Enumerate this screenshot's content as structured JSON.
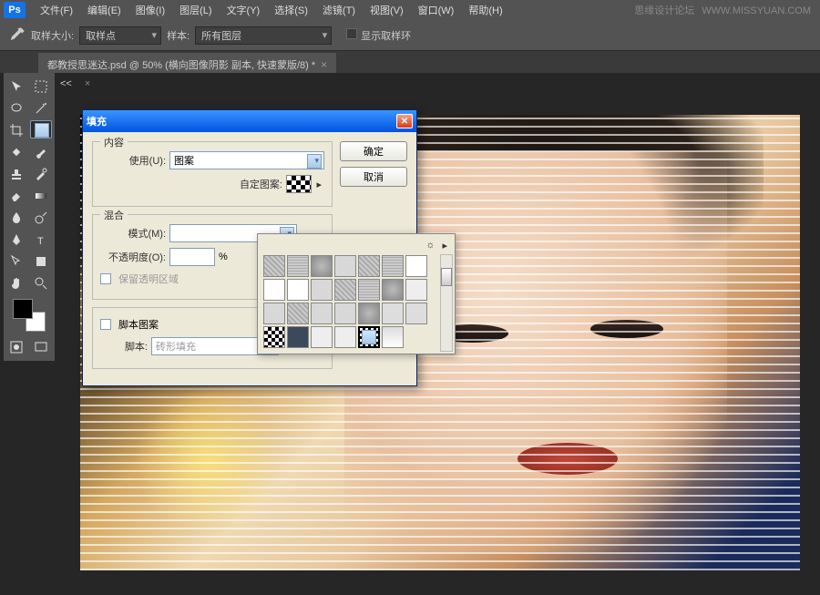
{
  "menubar": {
    "items": [
      "文件(F)",
      "编辑(E)",
      "图像(I)",
      "图层(L)",
      "文字(Y)",
      "选择(S)",
      "滤镜(T)",
      "视图(V)",
      "窗口(W)",
      "帮助(H)"
    ]
  },
  "watermark": {
    "site": "思缘设计论坛",
    "url": "WWW.MISSYUAN.COM"
  },
  "optbar": {
    "sample_size_label": "取样大小:",
    "sample_size_value": "取样点",
    "sample_label": "样本:",
    "sample_value": "所有图层",
    "show_ring": "显示取样环"
  },
  "tab": {
    "title": "都教授思迷达.psd @ 50% (横向图像阴影 副本, 快速蒙版/8) *"
  },
  "panel": {
    "tab1": "<<",
    "tab2": "×"
  },
  "dialog": {
    "title": "填充",
    "ok": "确定",
    "cancel": "取消",
    "g_content": "内容",
    "use_label": "使用(U):",
    "use_value": "图案",
    "custom_pattern": "自定图案:",
    "g_blend": "混合",
    "mode_label": "模式(M):",
    "opacity_label": "不透明度(O):",
    "opacity_suffix": "%",
    "preserve": "保留透明区域",
    "script_pattern": "脚本图案",
    "script_label": "脚本:",
    "script_value": "砖形填充"
  },
  "picker": {
    "menu": "▸",
    "more": "☼"
  }
}
